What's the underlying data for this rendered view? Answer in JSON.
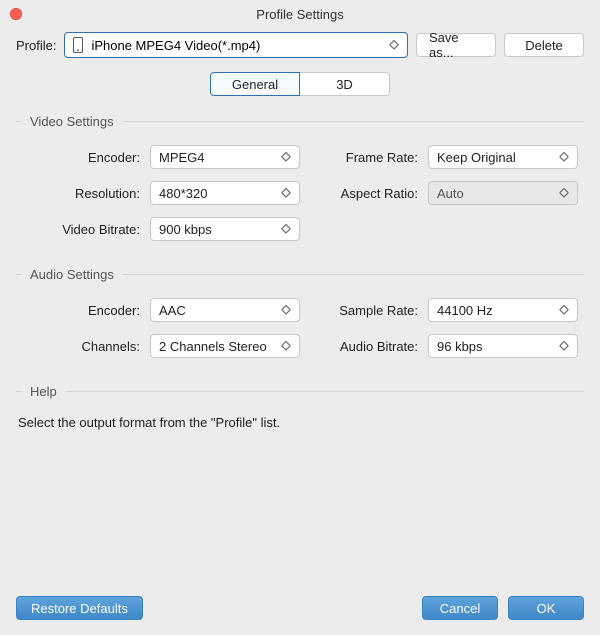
{
  "window": {
    "title": "Profile Settings"
  },
  "profile": {
    "label": "Profile:",
    "selected": "iPhone MPEG4 Video(*.mp4)",
    "save_as_label": "Save as...",
    "delete_label": "Delete"
  },
  "tabs": {
    "general": "General",
    "three_d": "3D"
  },
  "video": {
    "title": "Video Settings",
    "encoder_label": "Encoder:",
    "encoder_value": "MPEG4",
    "resolution_label": "Resolution:",
    "resolution_value": "480*320",
    "bitrate_label": "Video Bitrate:",
    "bitrate_value": "900 kbps",
    "framerate_label": "Frame Rate:",
    "framerate_value": "Keep Original",
    "aspect_label": "Aspect Ratio:",
    "aspect_value": "Auto"
  },
  "audio": {
    "title": "Audio Settings",
    "encoder_label": "Encoder:",
    "encoder_value": "AAC",
    "channels_label": "Channels:",
    "channels_value": "2 Channels Stereo",
    "samplerate_label": "Sample Rate:",
    "samplerate_value": "44100 Hz",
    "bitrate_label": "Audio Bitrate:",
    "bitrate_value": "96 kbps"
  },
  "help": {
    "title": "Help",
    "text": "Select the output format from the \"Profile\" list."
  },
  "footer": {
    "restore": "Restore Defaults",
    "cancel": "Cancel",
    "ok": "OK"
  }
}
